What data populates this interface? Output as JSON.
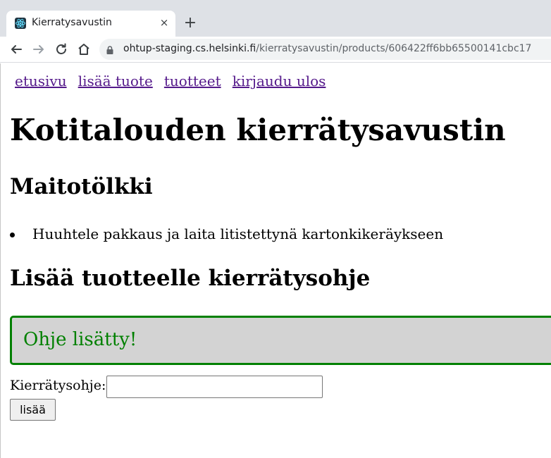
{
  "browser": {
    "tab_title": "Kierratysavustin",
    "tab_close": "×",
    "new_tab": "+",
    "url_host": "ohtup-staging.cs.helsinki.fi",
    "url_path": "/kierratysavustin/products/606422ff6bb65500141cbc17",
    "favicon": "react-icon"
  },
  "nav": {
    "home": "etusivu",
    "add_product": "lisää tuote",
    "products": "tuotteet",
    "logout": "kirjaudu ulos"
  },
  "page": {
    "title": "Kotitalouden kierrätysavustin",
    "product_name": "Maitotölkki",
    "instructions": [
      "Huuhtele pakkaus ja laita litistettynä kartonkikeräykseen"
    ],
    "add_heading": "Lisää tuotteelle kierrätysohje",
    "notification": "Ohje lisätty!",
    "form": {
      "label": "Kierrätysohje:",
      "input_value": "",
      "submit_label": "lisää"
    }
  },
  "colors": {
    "link": "#551a8b",
    "success_text": "#008000",
    "notification_bg": "#d3d3d3",
    "notification_border": "#008000"
  }
}
